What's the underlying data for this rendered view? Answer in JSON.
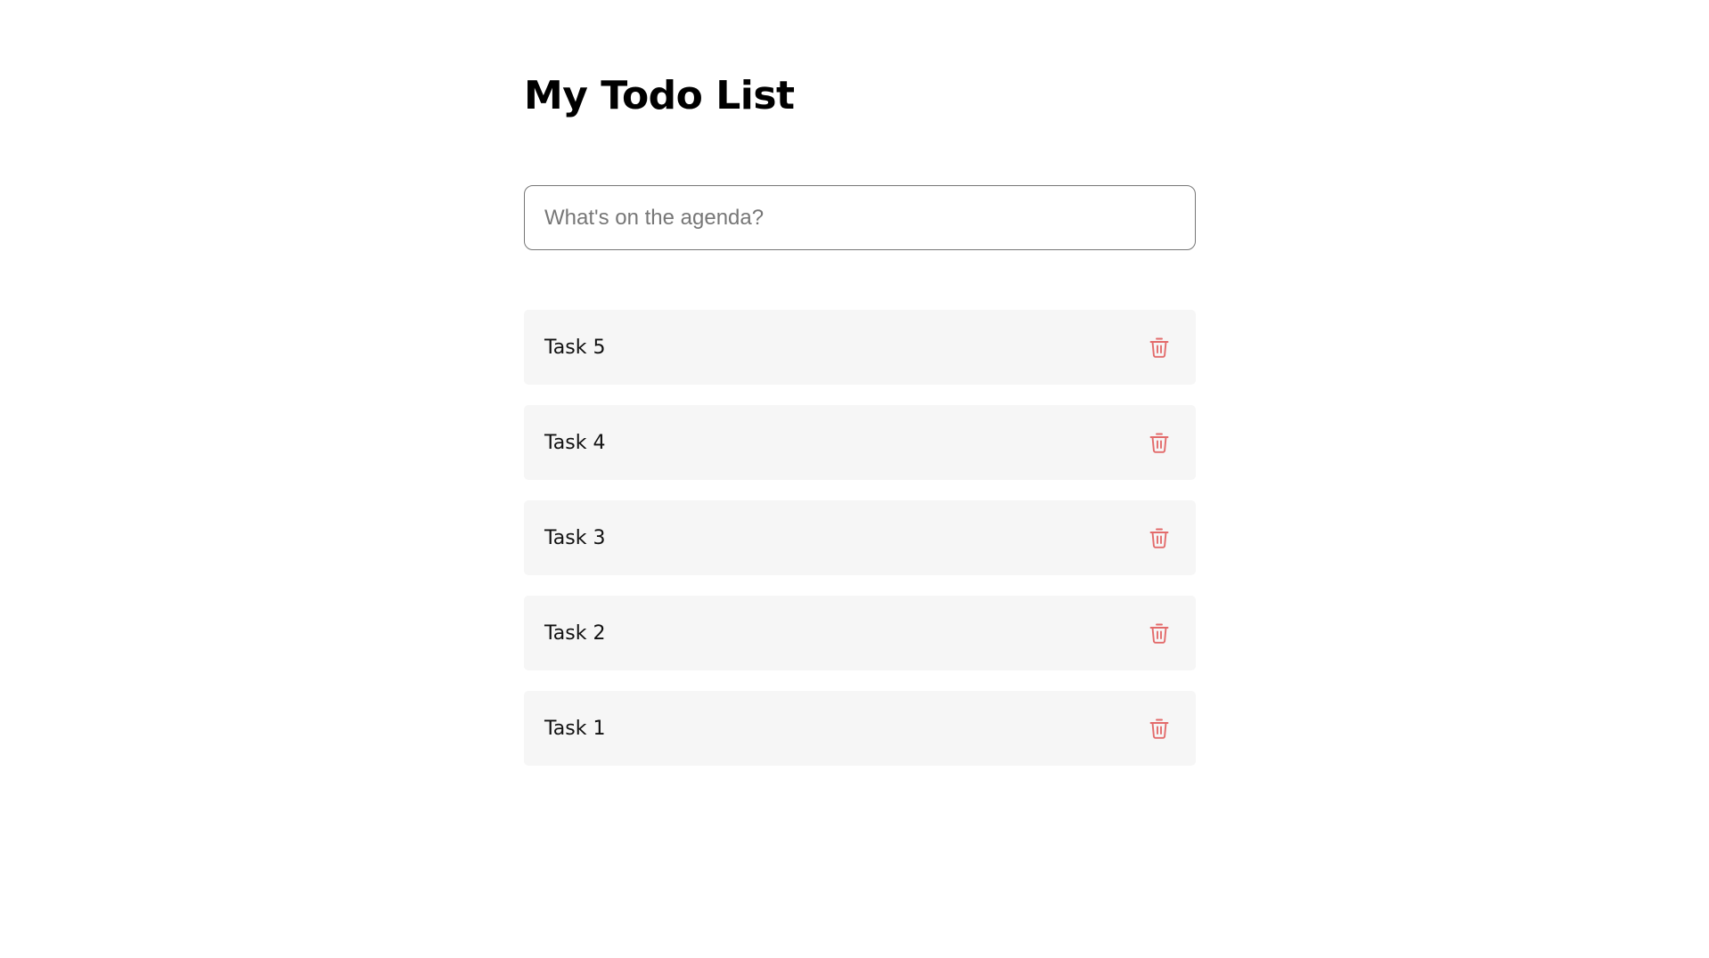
{
  "header": {
    "title": "My Todo List"
  },
  "new_todo": {
    "value": "",
    "placeholder": "What's on the agenda?"
  },
  "todos": [
    {
      "text": "Task 5",
      "delete_icon": "trash-icon"
    },
    {
      "text": "Task 4",
      "delete_icon": "trash-icon"
    },
    {
      "text": "Task 3",
      "delete_icon": "trash-icon"
    },
    {
      "text": "Task 2",
      "delete_icon": "trash-icon"
    },
    {
      "text": "Task 1",
      "delete_icon": "trash-icon"
    }
  ],
  "colors": {
    "background": "#ffffff",
    "item_background": "#f6f6f6",
    "delete_icon": "#e36b6b",
    "input_border": "#767676"
  }
}
